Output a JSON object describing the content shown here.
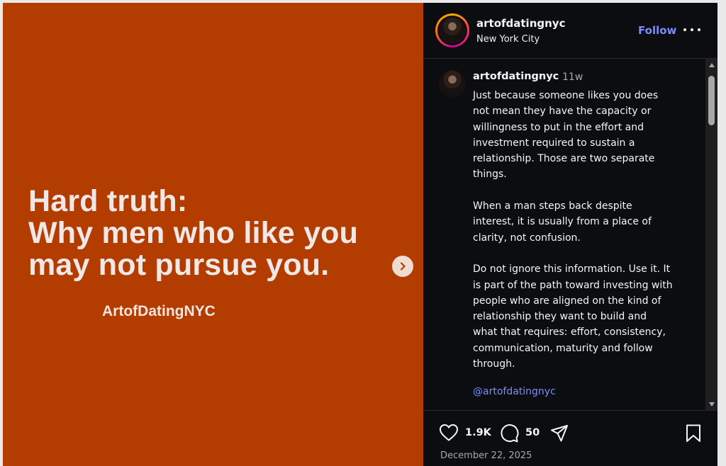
{
  "post": {
    "headline_lines": [
      "Hard truth:",
      "Why men who like you",
      "may not pursue you."
    ],
    "brand": "ArtofDatingNYC",
    "background_color": "#b33c00",
    "next_icon": "chevron-right-icon"
  },
  "header": {
    "username": "artofdatingnyc",
    "location": "New York City",
    "follow_label": "Follow",
    "more_icon": "more-horizontal-icon"
  },
  "caption": {
    "username": "artofdatingnyc",
    "time": "11w",
    "text": "Just because someone likes you does\nnot mean they have the capacity or\nwillingness to put in the effort and\ninvestment required to sustain a\nrelationship. Those are two separate\nthings.\n\nWhen a man steps back despite\ninterest, it is usually from a place of\nclarity, not confusion.\n\nDo not ignore this information. Use it. It\nis part of the path toward investing with\npeople who are aligned on the kind of\nrelationship they want to build and\nwhat that requires: effort, consistency,\ncommunication, maturity and follow\nthrough.",
    "mention": "@artofdatingnyc"
  },
  "actions": {
    "likes": "1.9K",
    "comments": "50",
    "icons": [
      "heart-icon",
      "comment-icon",
      "share-icon",
      "bookmark-icon"
    ]
  },
  "date": "December 22, 2025",
  "colors": {
    "accent": "#7c8cff",
    "panel_bg": "#0b0d10"
  }
}
